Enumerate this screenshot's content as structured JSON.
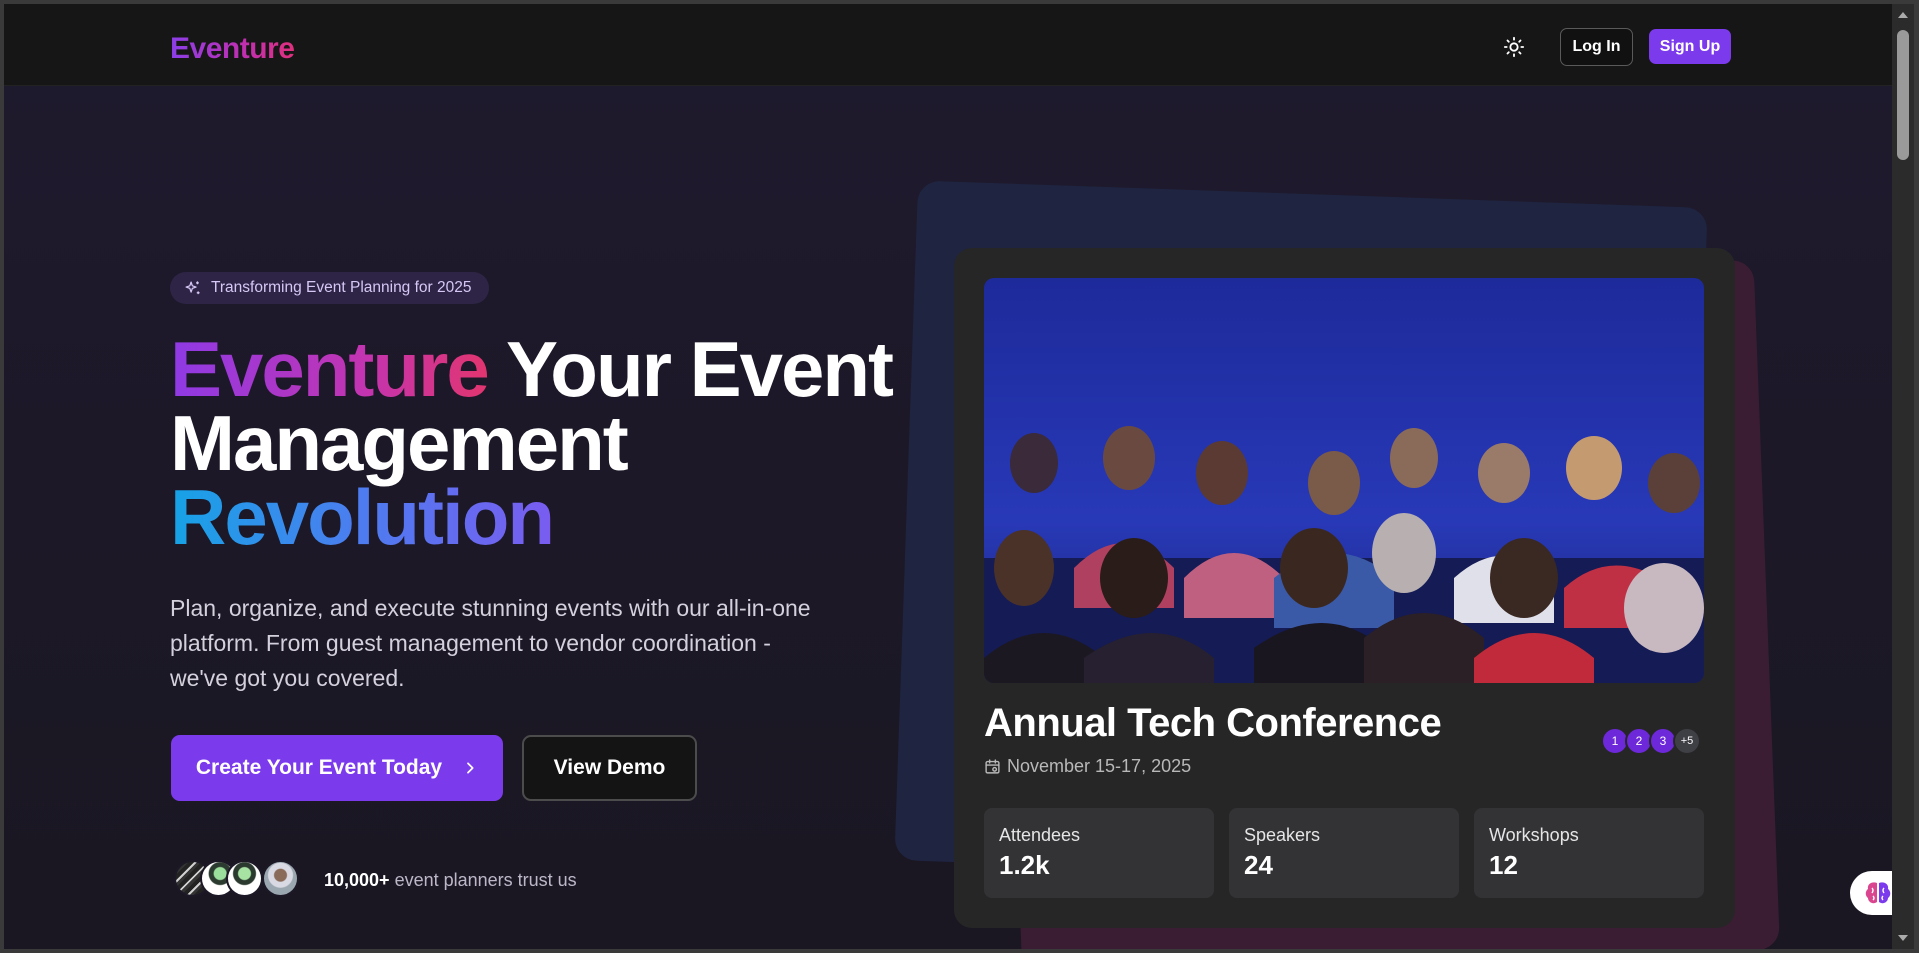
{
  "nav": {
    "logo": "Eventure",
    "theme_icon": "sun-icon",
    "login_label": "Log In",
    "signup_label": "Sign Up"
  },
  "hero": {
    "badge_icon": "sparkles-icon",
    "badge_text": "Transforming Event Planning for 2025",
    "headline_brand": "Eventure",
    "headline_part1": " Your Event",
    "headline_part2": "Management",
    "headline_part3": "Revolution",
    "description": "Plan, organize, and execute stunning events with our all-in-one platform. From guest management to vendor coordination - we've got you covered.",
    "cta_primary": "Create Your Event Today",
    "cta_primary_icon": "chevron-right-icon",
    "cta_secondary": "View Demo",
    "trust_count": "10,000+",
    "trust_text": " event planners trust us"
  },
  "event_card": {
    "title": "Annual Tech Conference",
    "date": "November 15-17, 2025",
    "date_icon": "calendar-icon",
    "attendee_dots": [
      "1",
      "2",
      "3",
      "+5"
    ],
    "stats": [
      {
        "label": "Attendees",
        "value": "1.2k"
      },
      {
        "label": "Speakers",
        "value": "24"
      },
      {
        "label": "Workshops",
        "value": "12"
      }
    ]
  },
  "floating": {
    "icon": "brain-icon"
  },
  "colors": {
    "accent": "#7c3aed",
    "nav_bg": "#161616",
    "card_bg": "#262626",
    "stat_bg": "#333336"
  }
}
